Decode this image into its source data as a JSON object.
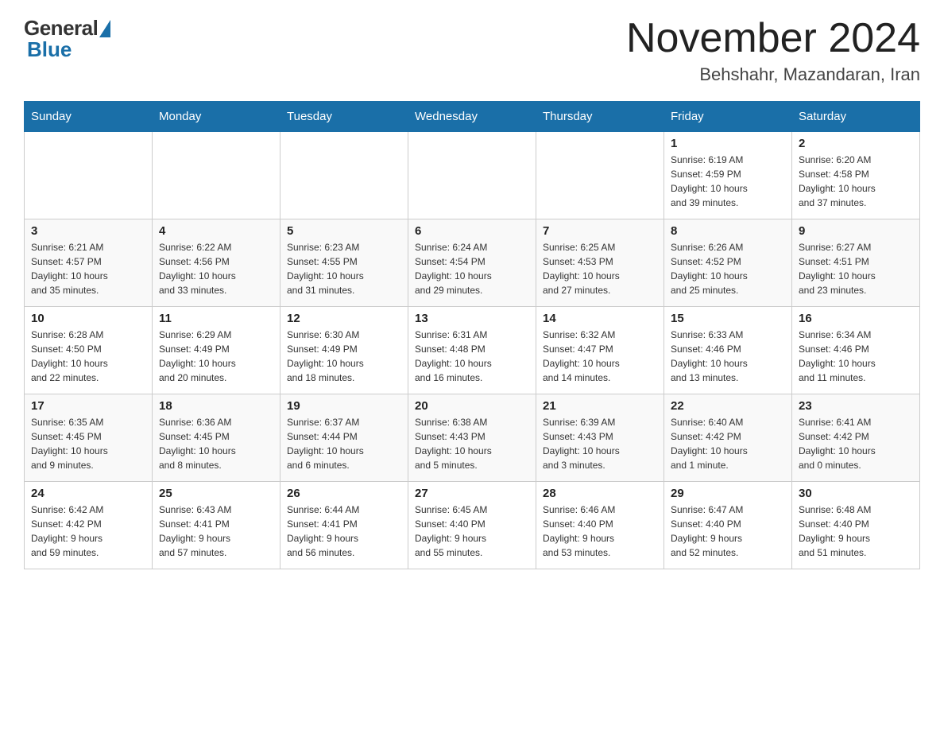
{
  "header": {
    "logo_general": "General",
    "logo_blue": "Blue",
    "month_year": "November 2024",
    "location": "Behshahr, Mazandaran, Iran"
  },
  "weekdays": [
    "Sunday",
    "Monday",
    "Tuesday",
    "Wednesday",
    "Thursday",
    "Friday",
    "Saturday"
  ],
  "weeks": [
    [
      {
        "day": "",
        "info": ""
      },
      {
        "day": "",
        "info": ""
      },
      {
        "day": "",
        "info": ""
      },
      {
        "day": "",
        "info": ""
      },
      {
        "day": "",
        "info": ""
      },
      {
        "day": "1",
        "info": "Sunrise: 6:19 AM\nSunset: 4:59 PM\nDaylight: 10 hours\nand 39 minutes."
      },
      {
        "day": "2",
        "info": "Sunrise: 6:20 AM\nSunset: 4:58 PM\nDaylight: 10 hours\nand 37 minutes."
      }
    ],
    [
      {
        "day": "3",
        "info": "Sunrise: 6:21 AM\nSunset: 4:57 PM\nDaylight: 10 hours\nand 35 minutes."
      },
      {
        "day": "4",
        "info": "Sunrise: 6:22 AM\nSunset: 4:56 PM\nDaylight: 10 hours\nand 33 minutes."
      },
      {
        "day": "5",
        "info": "Sunrise: 6:23 AM\nSunset: 4:55 PM\nDaylight: 10 hours\nand 31 minutes."
      },
      {
        "day": "6",
        "info": "Sunrise: 6:24 AM\nSunset: 4:54 PM\nDaylight: 10 hours\nand 29 minutes."
      },
      {
        "day": "7",
        "info": "Sunrise: 6:25 AM\nSunset: 4:53 PM\nDaylight: 10 hours\nand 27 minutes."
      },
      {
        "day": "8",
        "info": "Sunrise: 6:26 AM\nSunset: 4:52 PM\nDaylight: 10 hours\nand 25 minutes."
      },
      {
        "day": "9",
        "info": "Sunrise: 6:27 AM\nSunset: 4:51 PM\nDaylight: 10 hours\nand 23 minutes."
      }
    ],
    [
      {
        "day": "10",
        "info": "Sunrise: 6:28 AM\nSunset: 4:50 PM\nDaylight: 10 hours\nand 22 minutes."
      },
      {
        "day": "11",
        "info": "Sunrise: 6:29 AM\nSunset: 4:49 PM\nDaylight: 10 hours\nand 20 minutes."
      },
      {
        "day": "12",
        "info": "Sunrise: 6:30 AM\nSunset: 4:49 PM\nDaylight: 10 hours\nand 18 minutes."
      },
      {
        "day": "13",
        "info": "Sunrise: 6:31 AM\nSunset: 4:48 PM\nDaylight: 10 hours\nand 16 minutes."
      },
      {
        "day": "14",
        "info": "Sunrise: 6:32 AM\nSunset: 4:47 PM\nDaylight: 10 hours\nand 14 minutes."
      },
      {
        "day": "15",
        "info": "Sunrise: 6:33 AM\nSunset: 4:46 PM\nDaylight: 10 hours\nand 13 minutes."
      },
      {
        "day": "16",
        "info": "Sunrise: 6:34 AM\nSunset: 4:46 PM\nDaylight: 10 hours\nand 11 minutes."
      }
    ],
    [
      {
        "day": "17",
        "info": "Sunrise: 6:35 AM\nSunset: 4:45 PM\nDaylight: 10 hours\nand 9 minutes."
      },
      {
        "day": "18",
        "info": "Sunrise: 6:36 AM\nSunset: 4:45 PM\nDaylight: 10 hours\nand 8 minutes."
      },
      {
        "day": "19",
        "info": "Sunrise: 6:37 AM\nSunset: 4:44 PM\nDaylight: 10 hours\nand 6 minutes."
      },
      {
        "day": "20",
        "info": "Sunrise: 6:38 AM\nSunset: 4:43 PM\nDaylight: 10 hours\nand 5 minutes."
      },
      {
        "day": "21",
        "info": "Sunrise: 6:39 AM\nSunset: 4:43 PM\nDaylight: 10 hours\nand 3 minutes."
      },
      {
        "day": "22",
        "info": "Sunrise: 6:40 AM\nSunset: 4:42 PM\nDaylight: 10 hours\nand 1 minute."
      },
      {
        "day": "23",
        "info": "Sunrise: 6:41 AM\nSunset: 4:42 PM\nDaylight: 10 hours\nand 0 minutes."
      }
    ],
    [
      {
        "day": "24",
        "info": "Sunrise: 6:42 AM\nSunset: 4:42 PM\nDaylight: 9 hours\nand 59 minutes."
      },
      {
        "day": "25",
        "info": "Sunrise: 6:43 AM\nSunset: 4:41 PM\nDaylight: 9 hours\nand 57 minutes."
      },
      {
        "day": "26",
        "info": "Sunrise: 6:44 AM\nSunset: 4:41 PM\nDaylight: 9 hours\nand 56 minutes."
      },
      {
        "day": "27",
        "info": "Sunrise: 6:45 AM\nSunset: 4:40 PM\nDaylight: 9 hours\nand 55 minutes."
      },
      {
        "day": "28",
        "info": "Sunrise: 6:46 AM\nSunset: 4:40 PM\nDaylight: 9 hours\nand 53 minutes."
      },
      {
        "day": "29",
        "info": "Sunrise: 6:47 AM\nSunset: 4:40 PM\nDaylight: 9 hours\nand 52 minutes."
      },
      {
        "day": "30",
        "info": "Sunrise: 6:48 AM\nSunset: 4:40 PM\nDaylight: 9 hours\nand 51 minutes."
      }
    ]
  ]
}
